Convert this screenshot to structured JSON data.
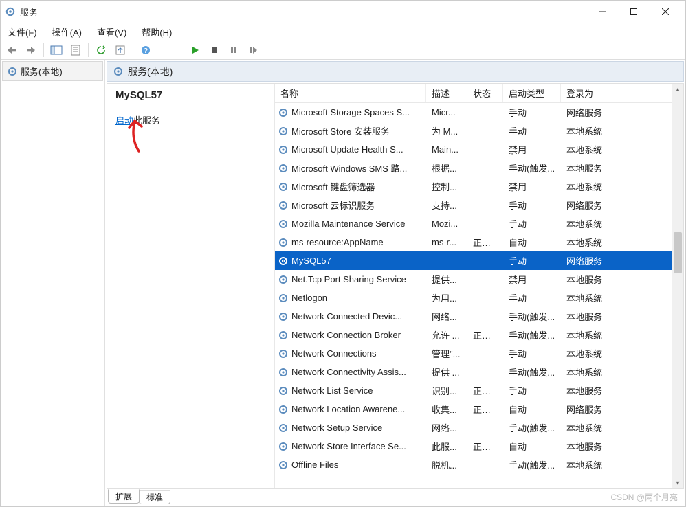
{
  "window": {
    "title": "服务"
  },
  "menu": {
    "file": "文件(F)",
    "action": "操作(A)",
    "view": "查看(V)",
    "help": "帮助(H)"
  },
  "nav": {
    "local": "服务(本地)"
  },
  "panel": {
    "header": "服务(本地)"
  },
  "details": {
    "selected_name": "MySQL57",
    "start_link": "启动",
    "start_suffix": "此服务"
  },
  "columns": {
    "name": "名称",
    "desc": "描述",
    "status": "状态",
    "startup": "启动类型",
    "logon": "登录为"
  },
  "tabs": {
    "extended": "扩展",
    "standard": "标准"
  },
  "watermark": "CSDN @两个月亮",
  "services": [
    {
      "name": "Microsoft Storage Spaces S...",
      "desc": "Micr...",
      "status": "",
      "startup": "手动",
      "logon": "网络服务",
      "selected": false
    },
    {
      "name": "Microsoft Store 安装服务",
      "desc": "为 M...",
      "status": "",
      "startup": "手动",
      "logon": "本地系统",
      "selected": false
    },
    {
      "name": "Microsoft Update Health S...",
      "desc": "Main...",
      "status": "",
      "startup": "禁用",
      "logon": "本地系统",
      "selected": false
    },
    {
      "name": "Microsoft Windows SMS 路...",
      "desc": "根据...",
      "status": "",
      "startup": "手动(触发...",
      "logon": "本地服务",
      "selected": false
    },
    {
      "name": "Microsoft 键盘筛选器",
      "desc": "控制...",
      "status": "",
      "startup": "禁用",
      "logon": "本地系统",
      "selected": false
    },
    {
      "name": "Microsoft 云标识服务",
      "desc": "支持...",
      "status": "",
      "startup": "手动",
      "logon": "网络服务",
      "selected": false
    },
    {
      "name": "Mozilla Maintenance Service",
      "desc": "Mozi...",
      "status": "",
      "startup": "手动",
      "logon": "本地系统",
      "selected": false
    },
    {
      "name": "ms-resource:AppName",
      "desc": "ms-r...",
      "status": "正在...",
      "startup": "自动",
      "logon": "本地系统",
      "selected": false
    },
    {
      "name": "MySQL57",
      "desc": "",
      "status": "",
      "startup": "手动",
      "logon": "网络服务",
      "selected": true
    },
    {
      "name": "Net.Tcp Port Sharing Service",
      "desc": "提供...",
      "status": "",
      "startup": "禁用",
      "logon": "本地服务",
      "selected": false
    },
    {
      "name": "Netlogon",
      "desc": "为用...",
      "status": "",
      "startup": "手动",
      "logon": "本地系统",
      "selected": false
    },
    {
      "name": "Network Connected Devic...",
      "desc": "网络...",
      "status": "",
      "startup": "手动(触发...",
      "logon": "本地服务",
      "selected": false
    },
    {
      "name": "Network Connection Broker",
      "desc": "允许 ...",
      "status": "正在...",
      "startup": "手动(触发...",
      "logon": "本地系统",
      "selected": false
    },
    {
      "name": "Network Connections",
      "desc": "管理\"...",
      "status": "",
      "startup": "手动",
      "logon": "本地系统",
      "selected": false
    },
    {
      "name": "Network Connectivity Assis...",
      "desc": "提供 ...",
      "status": "",
      "startup": "手动(触发...",
      "logon": "本地系统",
      "selected": false
    },
    {
      "name": "Network List Service",
      "desc": "识别...",
      "status": "正在...",
      "startup": "手动",
      "logon": "本地服务",
      "selected": false
    },
    {
      "name": "Network Location Awarene...",
      "desc": "收集...",
      "status": "正在...",
      "startup": "自动",
      "logon": "网络服务",
      "selected": false
    },
    {
      "name": "Network Setup Service",
      "desc": "网络...",
      "status": "",
      "startup": "手动(触发...",
      "logon": "本地系统",
      "selected": false
    },
    {
      "name": "Network Store Interface Se...",
      "desc": "此服...",
      "status": "正在...",
      "startup": "自动",
      "logon": "本地服务",
      "selected": false
    },
    {
      "name": "Offline Files",
      "desc": "脱机...",
      "status": "",
      "startup": "手动(触发...",
      "logon": "本地系统",
      "selected": false
    }
  ]
}
